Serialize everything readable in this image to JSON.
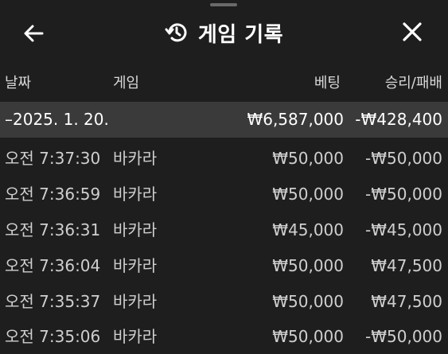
{
  "header": {
    "title": "게임 기록",
    "back_icon": "arrow-left-icon",
    "history_icon": "history-icon",
    "close_icon": "close-icon"
  },
  "columns": {
    "date": "날짜",
    "game": "게임",
    "bet": "베팅",
    "result": "승리/패배"
  },
  "date_group": {
    "label": "–2025. 1. 20.",
    "total_bet": "₩6,587,000",
    "total_result": "-₩428,400"
  },
  "rows": [
    {
      "time": "오전 7:37:30",
      "game": "바카라",
      "bet": "₩50,000",
      "result": "-₩50,000"
    },
    {
      "time": "오전 7:36:59",
      "game": "바카라",
      "bet": "₩50,000",
      "result": "-₩50,000"
    },
    {
      "time": "오전 7:36:31",
      "game": "바카라",
      "bet": "₩45,000",
      "result": "-₩45,000"
    },
    {
      "time": "오전 7:36:04",
      "game": "바카라",
      "bet": "₩50,000",
      "result": "₩47,500"
    },
    {
      "time": "오전 7:35:37",
      "game": "바카라",
      "bet": "₩50,000",
      "result": "₩47,500"
    },
    {
      "time": "오전 7:35:06",
      "game": "바카라",
      "bet": "₩50,000",
      "result": "-₩50,000"
    }
  ],
  "colors": {
    "background": "#1e1e1e",
    "date_row": "#3a3a3a",
    "text": "#cfcfcf",
    "title": "#ffffff"
  }
}
